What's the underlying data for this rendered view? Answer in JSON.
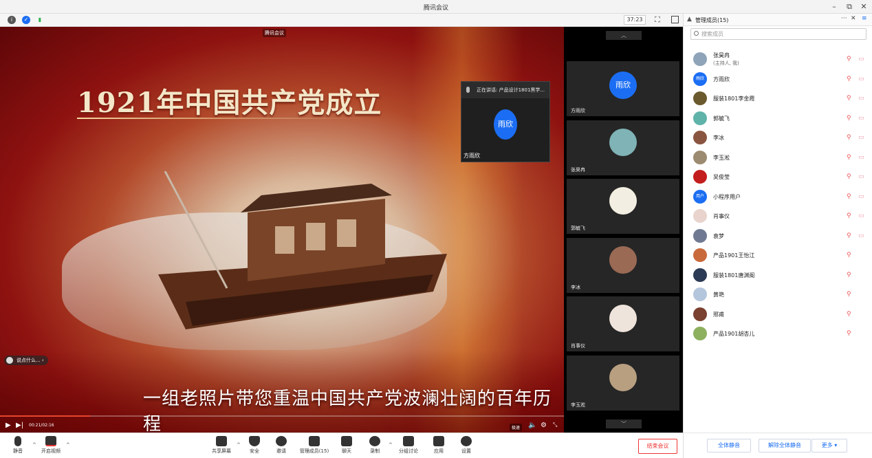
{
  "window": {
    "title": "腾讯会议"
  },
  "infobar": {
    "timer": "37:23"
  },
  "stage": {
    "mini_title": "腾讯会议",
    "headline": "1921年中国共产党成立",
    "subline": "一组老照片带您重温中国共产党波澜壮阔的百年历程",
    "chat_bubble": "说点什么...",
    "player_time": "00:21/02:16",
    "progress": 0.16,
    "quality_label": "极速"
  },
  "speaker": {
    "status": "正在讲话: 产品设计1801黑学...",
    "avatar_text": "雨欣",
    "name": "方雨欣"
  },
  "gallery": [
    {
      "name": "方雨欣",
      "avatar_text": "雨欣",
      "type": "blue"
    },
    {
      "name": "张昊冉",
      "avatar_text": "",
      "type": "img",
      "color": "#7fb3b5"
    },
    {
      "name": "郭毓飞",
      "avatar_text": "",
      "type": "img",
      "color": "#f2efe2"
    },
    {
      "name": "李冰",
      "avatar_text": "",
      "type": "img",
      "color": "#9a6a55"
    },
    {
      "name": "肖事仪",
      "avatar_text": "",
      "type": "img",
      "color": "#efe4dc"
    },
    {
      "name": "李玉淞",
      "avatar_text": "",
      "type": "img",
      "color": "#b89f80"
    }
  ],
  "toolbar": {
    "mute": "静音",
    "video": "开启视频",
    "share": "共享屏幕",
    "security": "安全",
    "invite": "邀请",
    "manage": "管理成员(15)",
    "chat": "聊天",
    "record": "录制",
    "breakout": "分组讨论",
    "apps": "应用",
    "settings": "设置",
    "end": "结束会议"
  },
  "panel": {
    "title": "管理成员(15)",
    "search_placeholder": "搜索成员",
    "members": [
      {
        "name": "张昊冉",
        "sub": "(主持人, 我)",
        "color": "#8fa4b8",
        "avatar_text": ""
      },
      {
        "name": "方雨欣",
        "sub": "",
        "color": "#1b6ef3",
        "avatar_text": "雨欣"
      },
      {
        "name": "服装1801李金霞",
        "sub": "",
        "color": "#6b5a2e",
        "avatar_text": ""
      },
      {
        "name": "郭毓飞",
        "sub": "",
        "color": "#5fb3a8",
        "avatar_text": ""
      },
      {
        "name": "李冰",
        "sub": "",
        "color": "#8a5540",
        "avatar_text": ""
      },
      {
        "name": "李玉淞",
        "sub": "",
        "color": "#9c8b70",
        "avatar_text": ""
      },
      {
        "name": "吴俊莹",
        "sub": "",
        "color": "#c31d1d",
        "avatar_text": ""
      },
      {
        "name": "小程序用户",
        "sub": "",
        "color": "#1b6ef3",
        "avatar_text": "用户"
      },
      {
        "name": "肖事仪",
        "sub": "",
        "color": "#e8d4cc",
        "avatar_text": ""
      },
      {
        "name": "袁梦",
        "sub": "",
        "color": "#6f7a92",
        "avatar_text": ""
      },
      {
        "name": "产品1901王怡江",
        "sub": "",
        "color": "#c86a3c",
        "avatar_text": ""
      },
      {
        "name": "服装1801唐渊阁",
        "sub": "",
        "color": "#2d3a55",
        "avatar_text": ""
      },
      {
        "name": "黄艳",
        "sub": "",
        "color": "#b4c6dc",
        "avatar_text": ""
      },
      {
        "name": "邢甫",
        "sub": "",
        "color": "#7a4030",
        "avatar_text": ""
      },
      {
        "name": "产品1901胡杏儿",
        "sub": "",
        "color": "#8db05e",
        "avatar_text": ""
      }
    ],
    "mute_all": "全体静音",
    "unmute_all": "解除全体静音",
    "more": "更多 ▾"
  }
}
